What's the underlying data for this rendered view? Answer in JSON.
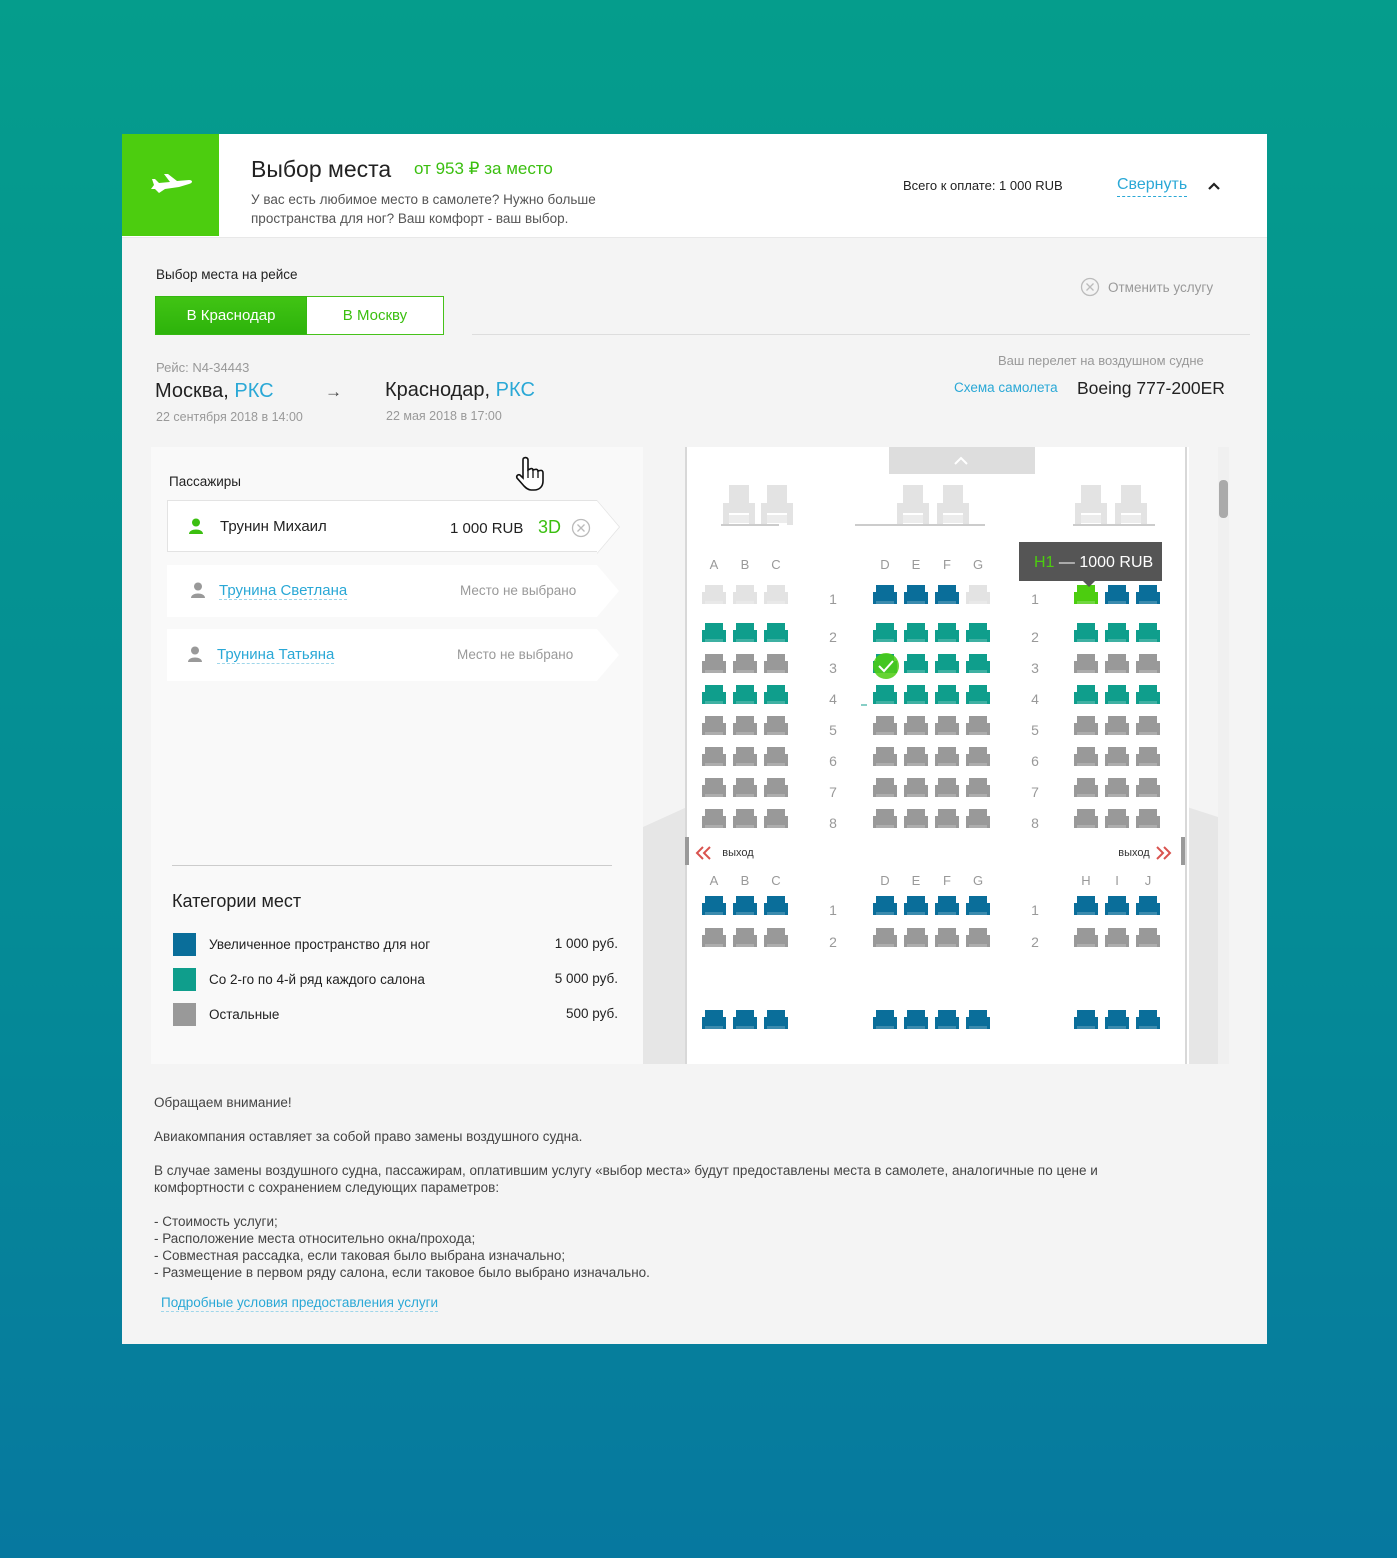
{
  "header": {
    "title": "Выбор места",
    "price_from": "от 953 ₽ за место",
    "description": "У вас есть любимое место в самолете? Нужно больше пространства для ног? Ваш комфорт - ваш выбор.",
    "total": "Всего к оплате: 1 000 RUB",
    "collapse": "Свернуть",
    "plane_icon": "airplane-icon",
    "chevron_icon": "chevron-up-icon"
  },
  "flight_select": {
    "label": "Выбор места на рейсе",
    "tabs": [
      "В Краснодар",
      "В Москву"
    ],
    "active_tab": "В Краснодар",
    "cancel": "Отменить услугу"
  },
  "flight": {
    "number": "Рейс: N4-34443",
    "from_city": "Москва,",
    "from_code": "РКС",
    "from_date": "22 сентября 2018 в 14:00",
    "arrow": "→",
    "to_city": "Краснодар,",
    "to_code": "РКС",
    "to_date": "22 мая 2018 в 17:00",
    "aircraft_label": "Ваш перелет на воздушном судне",
    "scheme_link": "Схема самолета",
    "aircraft": "Boeing 777-200ER"
  },
  "passengers": {
    "title": "Пассажиры",
    "list": [
      {
        "name": "Трунин Михаил",
        "price": "1 000 RUB",
        "seat": "3D",
        "status": ""
      },
      {
        "name": "Трунина Светлана",
        "price": "",
        "seat": "",
        "status": "Место не выбрано"
      },
      {
        "name": "Трунина Татьяна",
        "price": "",
        "seat": "",
        "status": "Место не выбрано"
      }
    ]
  },
  "categories": {
    "title": "Категории мест",
    "items": [
      {
        "label": "Увеличенное пространство для ног",
        "price": "1 000 руб.",
        "color": "#0a6e9a"
      },
      {
        "label": "Со 2-го по 4-й ряд каждого салона",
        "price": "5 000 руб.",
        "color": "#0f9e8c"
      },
      {
        "label": "Остальные",
        "price": "500 руб.",
        "color": "#999999"
      }
    ]
  },
  "seatmap": {
    "cols_left": [
      "A",
      "B",
      "C"
    ],
    "cols_mid": [
      "D",
      "E",
      "F",
      "G"
    ],
    "cols_right_hidden_by_tooltip": [
      "H",
      "I",
      "J"
    ],
    "cols_right": [
      "H",
      "I",
      "J"
    ],
    "rows_cabin1": [
      "1",
      "2",
      "3",
      "4",
      "5",
      "6",
      "7",
      "8"
    ],
    "rows_cabin2": [
      "1",
      "2"
    ],
    "exit_label": "выход",
    "tooltip_seat": "H1",
    "tooltip_price": " — 1000 RUB",
    "selected_seat": "3D",
    "hover_seat": "H1",
    "colors": {
      "blue": "#0a6e9a",
      "teal": "#0f9e8c",
      "gray": "#999999",
      "empty": "#e3e3e3",
      "green": "#4ccd0f"
    }
  },
  "notes": {
    "attention": "Обращаем внимание!",
    "p1": "Авиакомпания оставляет за собой право замены воздушного судна.",
    "p2": "В случае замены воздушного судна, пассажирам, оплатившим услугу «выбор места» будут предоставлены места в самолете, аналогичные по цене и комфортности с сохранением следующих параметров:",
    "list": [
      "- Стоимость услуги;",
      "- Расположение места относительно окна/прохода;",
      "- Совместная рассадка, если таковая было выбрана изначально;",
      "- Размещение в первом ряду салона, если таковое было выбрано изначально."
    ],
    "link": "Подробные условия предоставления услуги"
  }
}
